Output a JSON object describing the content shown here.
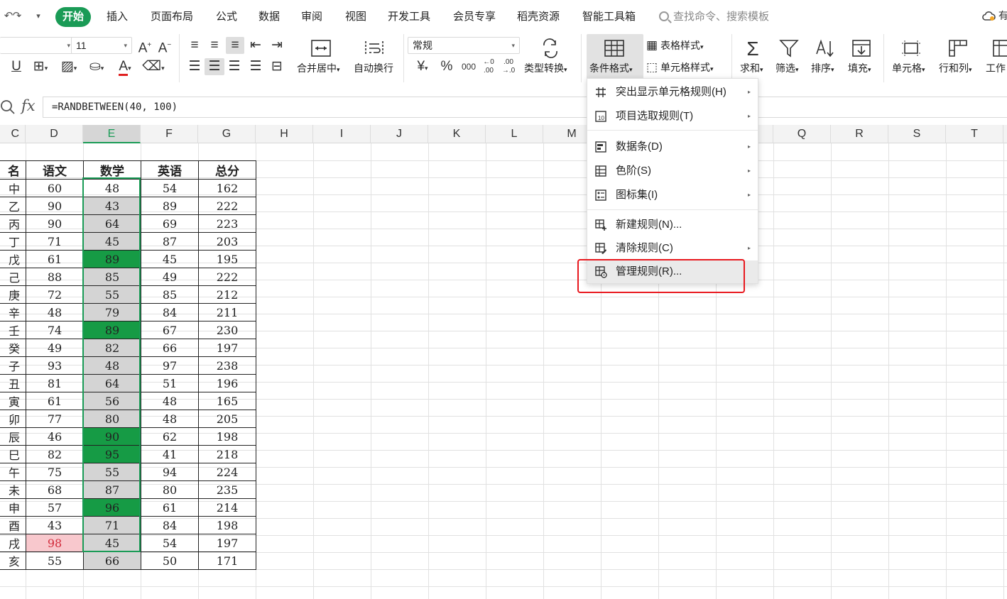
{
  "menubar": {
    "tabs": [
      {
        "label": "开始",
        "active": true
      },
      {
        "label": "插入"
      },
      {
        "label": "页面布局"
      },
      {
        "label": "公式"
      },
      {
        "label": "数据"
      },
      {
        "label": "审阅"
      },
      {
        "label": "视图"
      },
      {
        "label": "开发工具"
      },
      {
        "label": "会员专享"
      },
      {
        "label": "稻壳资源"
      },
      {
        "label": "智能工具箱"
      }
    ],
    "search_placeholder": "查找命令、搜索模板",
    "cloud_label": "有",
    "accent_color": "#1a9b56"
  },
  "ribbon": {
    "font_size": "11",
    "number_format": "常规",
    "merge_label": "合并居中",
    "wrap_label": "自动换行",
    "type_convert_label": "类型转换",
    "cond_format_label": "条件格式",
    "table_style_label": "表格样式",
    "cell_style_label": "单元格样式",
    "sum_label": "求和",
    "filter_label": "筛选",
    "sort_label": "排序",
    "fill_label": "填充",
    "cell_label": "单元格",
    "rowcol_label": "行和列",
    "worksheet_label": "工作",
    "currency_symbol": "¥",
    "percent_symbol": "%",
    "thousands_symbol": "000"
  },
  "formula_bar": {
    "fx": "fx",
    "formula": "=RANDBETWEEN(40, 100)"
  },
  "columns": [
    "C",
    "D",
    "E",
    "F",
    "G",
    "H",
    "I",
    "J",
    "K",
    "L",
    "M",
    "Q",
    "R",
    "S",
    "T"
  ],
  "selected_column": "E",
  "table": {
    "headers": [
      "名",
      "语文",
      "数学",
      "英语",
      "总分"
    ],
    "rows": [
      {
        "name": "中",
        "d": "60",
        "e": "48",
        "f": "54",
        "g": "162",
        "e_style": "plain"
      },
      {
        "name": "乙",
        "d": "90",
        "e": "43",
        "f": "89",
        "g": "222",
        "e_style": "grey"
      },
      {
        "name": "丙",
        "d": "90",
        "e": "64",
        "f": "69",
        "g": "223",
        "e_style": "grey"
      },
      {
        "name": "丁",
        "d": "71",
        "e": "45",
        "f": "87",
        "g": "203",
        "e_style": "grey"
      },
      {
        "name": "戊",
        "d": "61",
        "e": "89",
        "f": "45",
        "g": "195",
        "e_style": "green"
      },
      {
        "name": "己",
        "d": "88",
        "e": "85",
        "f": "49",
        "g": "222",
        "e_style": "grey"
      },
      {
        "name": "庚",
        "d": "72",
        "e": "55",
        "f": "85",
        "g": "212",
        "e_style": "grey"
      },
      {
        "name": "辛",
        "d": "48",
        "e": "79",
        "f": "84",
        "g": "211",
        "e_style": "grey"
      },
      {
        "name": "壬",
        "d": "74",
        "e": "89",
        "f": "67",
        "g": "230",
        "e_style": "green"
      },
      {
        "name": "癸",
        "d": "49",
        "e": "82",
        "f": "66",
        "g": "197",
        "e_style": "grey"
      },
      {
        "name": "子",
        "d": "93",
        "e": "48",
        "f": "97",
        "g": "238",
        "e_style": "grey"
      },
      {
        "name": "丑",
        "d": "81",
        "e": "64",
        "f": "51",
        "g": "196",
        "e_style": "grey"
      },
      {
        "name": "寅",
        "d": "61",
        "e": "56",
        "f": "48",
        "g": "165",
        "e_style": "grey"
      },
      {
        "name": "卯",
        "d": "77",
        "e": "80",
        "f": "48",
        "g": "205",
        "e_style": "grey"
      },
      {
        "name": "辰",
        "d": "46",
        "e": "90",
        "f": "62",
        "g": "198",
        "e_style": "green"
      },
      {
        "name": "巳",
        "d": "82",
        "e": "95",
        "f": "41",
        "g": "218",
        "e_style": "green"
      },
      {
        "name": "午",
        "d": "75",
        "e": "55",
        "f": "94",
        "g": "224",
        "e_style": "grey"
      },
      {
        "name": "未",
        "d": "68",
        "e": "87",
        "f": "80",
        "g": "235",
        "e_style": "grey"
      },
      {
        "name": "申",
        "d": "57",
        "e": "96",
        "f": "61",
        "g": "214",
        "e_style": "green"
      },
      {
        "name": "酉",
        "d": "43",
        "e": "71",
        "f": "84",
        "g": "198",
        "e_style": "grey"
      },
      {
        "name": "戌",
        "d": "98",
        "e": "45",
        "f": "54",
        "g": "197",
        "e_style": "grey",
        "d_style": "pink"
      },
      {
        "name": "亥",
        "d": "55",
        "e": "66",
        "f": "50",
        "g": "171",
        "e_style": "grey"
      }
    ],
    "colors": {
      "grey": "#d4d4d4",
      "green": "#169b45",
      "pink": "#f8c8cd",
      "pink_text": "#d22a3a"
    }
  },
  "cf_menu": {
    "items": [
      {
        "label": "突出显示单元格规则(H)",
        "icon": "highlight-rules-icon",
        "submenu": true
      },
      {
        "label": "项目选取规则(T)",
        "icon": "top-bottom-rules-icon",
        "submenu": true
      },
      {
        "label": "数据条(D)",
        "icon": "data-bars-icon",
        "submenu": true
      },
      {
        "label": "色阶(S)",
        "icon": "color-scales-icon",
        "submenu": true
      },
      {
        "label": "图标集(I)",
        "icon": "icon-sets-icon",
        "submenu": true
      },
      {
        "label": "新建规则(N)...",
        "icon": "new-rule-icon",
        "submenu": false
      },
      {
        "label": "清除规则(C)",
        "icon": "clear-rules-icon",
        "submenu": true
      },
      {
        "label": "管理规则(R)...",
        "icon": "manage-rules-icon",
        "submenu": false,
        "hover": true
      }
    ],
    "highlight_color": "#e8191f"
  }
}
